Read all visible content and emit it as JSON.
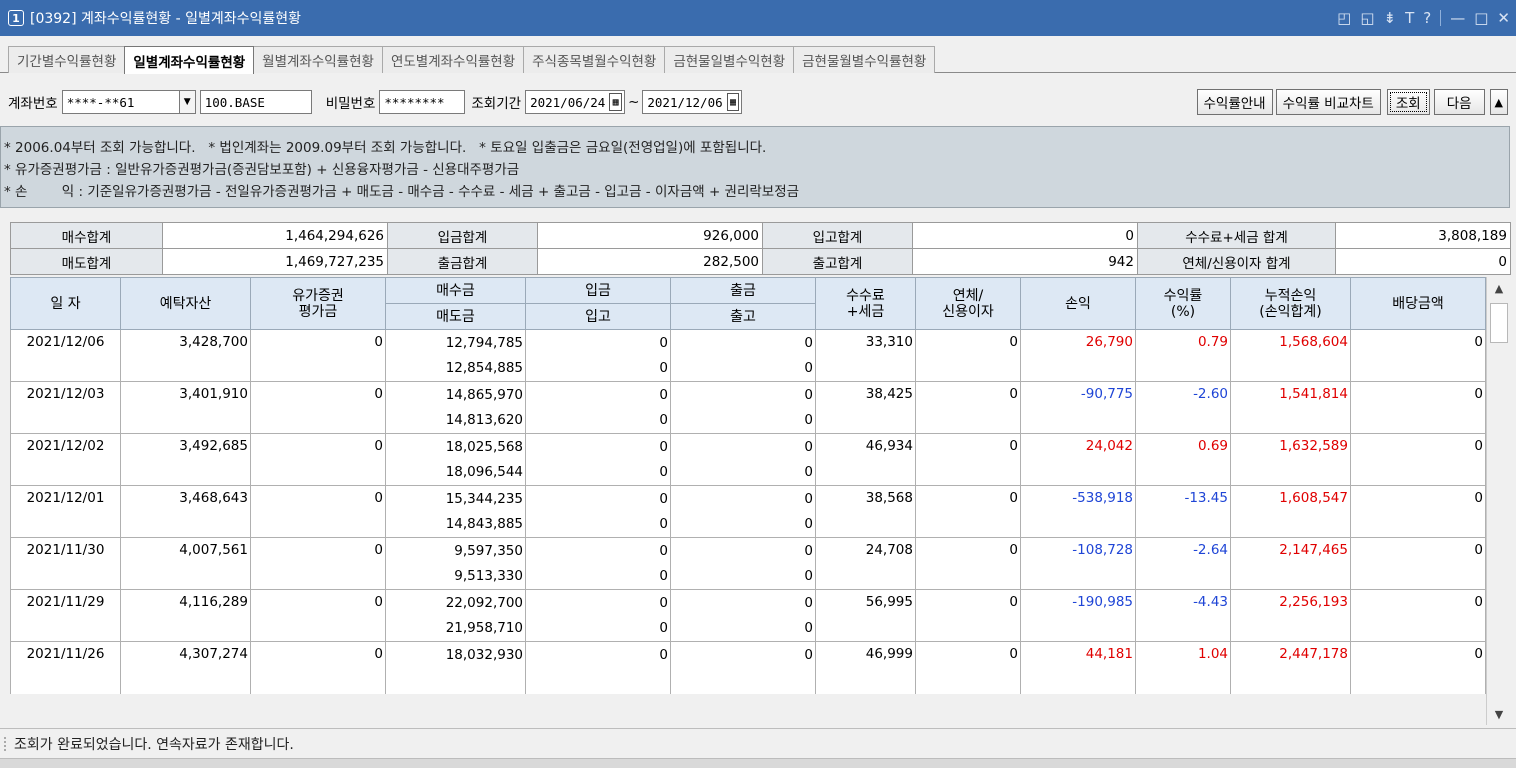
{
  "window": {
    "number": "1",
    "title": "[0392] 계좌수익률현황 - 일별계좌수익률현황",
    "controls": [
      "◰",
      "◱",
      "⇟",
      "T",
      "?",
      "—",
      "□",
      "✕"
    ]
  },
  "tabs": [
    {
      "label": "기간별수익률현황",
      "active": false
    },
    {
      "label": "일별계좌수익률현황",
      "active": true
    },
    {
      "label": "월별계좌수익률현황",
      "active": false
    },
    {
      "label": "연도별계좌수익률현황",
      "active": false
    },
    {
      "label": "주식종목별월수익현황",
      "active": false
    },
    {
      "label": "금현물일별수익현황",
      "active": false
    },
    {
      "label": "금현물월별수익률현황",
      "active": false
    }
  ],
  "toolbar": {
    "account_label": "계좌번호",
    "account_value": "****-**61",
    "account_name": "100.BASE",
    "password_label": "비밀번호",
    "password_value": "********",
    "period_label": "조회기간",
    "date_from": "2021/06/24",
    "date_sep": "~",
    "date_to": "2021/12/06",
    "guide_button": "수익률안내",
    "compare_button": "수익률 비교차트",
    "query_button": "조회",
    "next_button": "다음",
    "collapse_button": "▲"
  },
  "notes": [
    "* 2006.04부터 조회 가능합니다.   * 법인계좌는 2009.09부터 조회 가능합니다.   * 토요일 입출금은 금요일(전영업일)에 포함됩니다.",
    "* 유가증권평가금 : 일반유가증권평가금(증권담보포함) + 신용융자평가금 - 신용대주평가금",
    "* 손        익 : 기준일유가증권평가금 - 전일유가증권평가금 + 매도금 - 매수금 - 수수료 - 세금 + 출고금 - 입고금 - 이자금액 + 권리락보정금"
  ],
  "summary": {
    "buy_total_label": "매수합계",
    "buy_total": "1,464,294,626",
    "sell_total_label": "매도합계",
    "sell_total": "1,469,727,235",
    "deposit_total_label": "입금합계",
    "deposit_total": "926,000",
    "withdraw_total_label": "출금합계",
    "withdraw_total": "282,500",
    "in_total_label": "입고합계",
    "in_total": "0",
    "out_total_label": "출고합계",
    "out_total": "942",
    "fee_total_label": "수수료+세금 합계",
    "fee_total": "3,808,189",
    "interest_total_label": "연체/신용이자 합계",
    "interest_total": "0"
  },
  "grid": {
    "headers": {
      "date": "일 자",
      "deposit_assets": "예탁자산",
      "securities_line1": "유가증권",
      "securities_line2": "평가금",
      "buy": "매수금",
      "sell": "매도금",
      "deposit": "입금",
      "stock_in": "입고",
      "withdraw": "출금",
      "stock_out": "출고",
      "fee_line1": "수수료",
      "fee_line2": "+세금",
      "interest_line1": "연체/",
      "interest_line2": "신용이자",
      "pnl": "손익",
      "rate_line1": "수익률",
      "rate_line2": "(%)",
      "cum_line1": "누적손익",
      "cum_line2": "(손익합계)",
      "dividend": "배당금액"
    },
    "rows": [
      {
        "date": "2021/12/06",
        "assets": "3,428,700",
        "securities": "0",
        "buy": "12,794,785",
        "sell": "12,854,885",
        "deposit": "0",
        "stock_in": "0",
        "withdraw": "0",
        "stock_out": "0",
        "fee": "33,310",
        "interest": "0",
        "pnl": "26,790",
        "rate": "0.79",
        "cum": "1,568,604",
        "dividend": "0"
      },
      {
        "date": "2021/12/03",
        "assets": "3,401,910",
        "securities": "0",
        "buy": "14,865,970",
        "sell": "14,813,620",
        "deposit": "0",
        "stock_in": "0",
        "withdraw": "0",
        "stock_out": "0",
        "fee": "38,425",
        "interest": "0",
        "pnl": "-90,775",
        "rate": "-2.60",
        "cum": "1,541,814",
        "dividend": "0"
      },
      {
        "date": "2021/12/02",
        "assets": "3,492,685",
        "securities": "0",
        "buy": "18,025,568",
        "sell": "18,096,544",
        "deposit": "0",
        "stock_in": "0",
        "withdraw": "0",
        "stock_out": "0",
        "fee": "46,934",
        "interest": "0",
        "pnl": "24,042",
        "rate": "0.69",
        "cum": "1,632,589",
        "dividend": "0"
      },
      {
        "date": "2021/12/01",
        "assets": "3,468,643",
        "securities": "0",
        "buy": "15,344,235",
        "sell": "14,843,885",
        "deposit": "0",
        "stock_in": "0",
        "withdraw": "0",
        "stock_out": "0",
        "fee": "38,568",
        "interest": "0",
        "pnl": "-538,918",
        "rate": "-13.45",
        "cum": "1,608,547",
        "dividend": "0"
      },
      {
        "date": "2021/11/30",
        "assets": "4,007,561",
        "securities": "0",
        "buy": "9,597,350",
        "sell": "9,513,330",
        "deposit": "0",
        "stock_in": "0",
        "withdraw": "0",
        "stock_out": "0",
        "fee": "24,708",
        "interest": "0",
        "pnl": "-108,728",
        "rate": "-2.64",
        "cum": "2,147,465",
        "dividend": "0"
      },
      {
        "date": "2021/11/29",
        "assets": "4,116,289",
        "securities": "0",
        "buy": "22,092,700",
        "sell": "21,958,710",
        "deposit": "0",
        "stock_in": "0",
        "withdraw": "0",
        "stock_out": "0",
        "fee": "56,995",
        "interest": "0",
        "pnl": "-190,985",
        "rate": "-4.43",
        "cum": "2,256,193",
        "dividend": "0"
      },
      {
        "date": "2021/11/26",
        "assets": "4,307,274",
        "securities": "0",
        "buy": "18,032,930",
        "sell": "",
        "deposit": "0",
        "stock_in": "",
        "withdraw": "0",
        "stock_out": "",
        "fee": "46,999",
        "interest": "0",
        "pnl": "44,181",
        "rate": "1.04",
        "cum": "2,447,178",
        "dividend": "0"
      }
    ]
  },
  "colors": {
    "titlebar": "#3a6cae",
    "loss": "#1f45d6",
    "gain": "#e00000",
    "header_bg": "#dde8f4",
    "notes_bg": "#cfd7dd"
  },
  "status": "조회가 완료되었습니다. 연속자료가 존재합니다."
}
